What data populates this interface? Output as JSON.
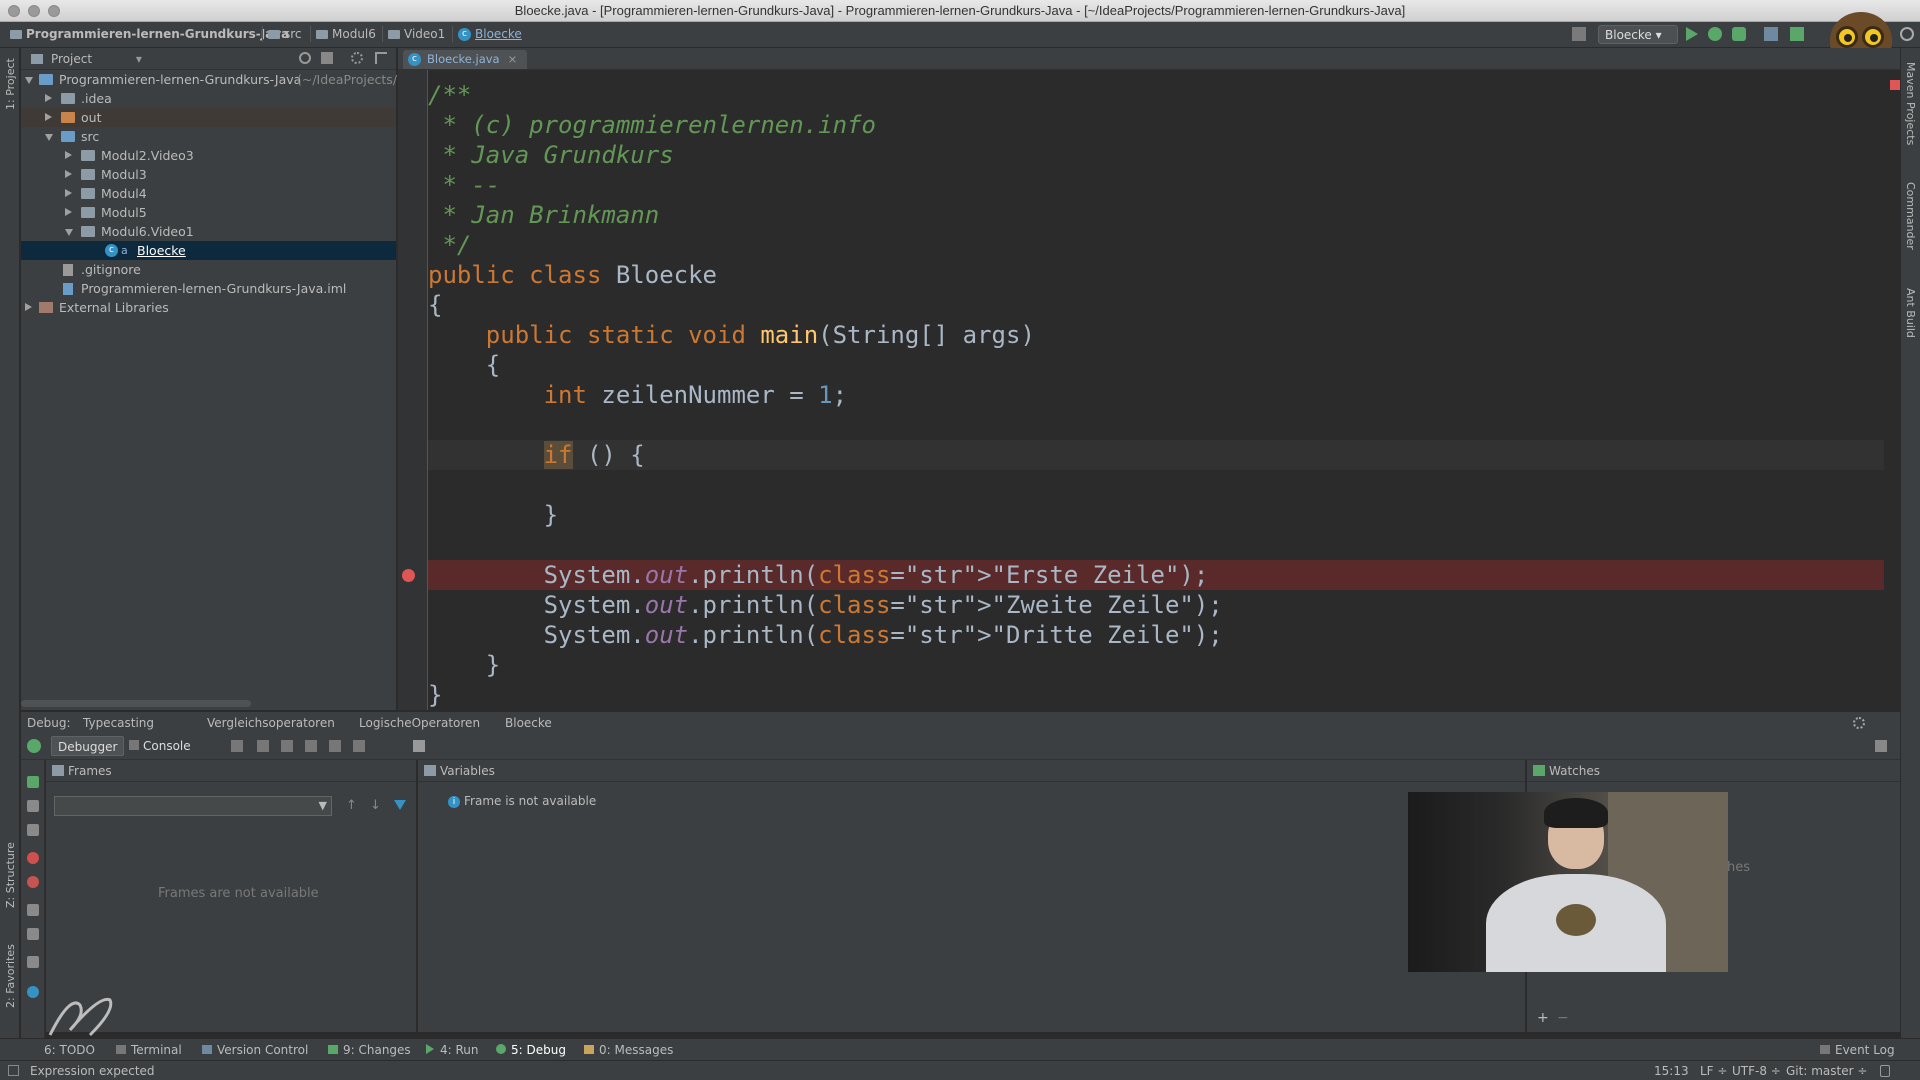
{
  "window": {
    "title": "Bloecke.java - [Programmieren-lernen-Grundkurs-Java] - Programmieren-lernen-Grundkurs-Java - [~/IdeaProjects/Programmieren-lernen-Grundkurs-Java]"
  },
  "navbar": {
    "breadcrumbs": [
      "Programmieren-lernen-Grundkurs-Java",
      "src",
      "Modul6",
      "Video1",
      "Bloecke"
    ],
    "run_config": "Bloecke"
  },
  "left_stripe": {
    "project": "1: Project",
    "structure": "Z: Structure",
    "favorites": "2: Favorites"
  },
  "right_stripe": {
    "maven": "Maven Projects",
    "commander": "Commander",
    "ant": "Ant Build"
  },
  "project_panel": {
    "header": "Project",
    "tree": [
      {
        "label": "Programmieren-lernen-Grundkurs-Java",
        "suffix": "(~/IdeaProjects/P",
        "depth": 0,
        "expanded": true,
        "icon": "module-folder-icon"
      },
      {
        "label": ".idea",
        "depth": 1,
        "expanded": false,
        "icon": "folder-icon"
      },
      {
        "label": "out",
        "depth": 1,
        "expanded": false,
        "icon": "excluded-folder-icon"
      },
      {
        "label": "src",
        "depth": 1,
        "expanded": true,
        "icon": "source-folder-icon"
      },
      {
        "label": "Modul2.Video3",
        "depth": 2,
        "expanded": false,
        "icon": "package-icon"
      },
      {
        "label": "Modul3",
        "depth": 2,
        "expanded": false,
        "icon": "package-icon"
      },
      {
        "label": "Modul4",
        "depth": 2,
        "expanded": false,
        "icon": "package-icon"
      },
      {
        "label": "Modul5",
        "depth": 2,
        "expanded": false,
        "icon": "package-icon"
      },
      {
        "label": "Modul6.Video1",
        "depth": 2,
        "expanded": true,
        "icon": "package-icon"
      },
      {
        "label": "Bloecke",
        "depth": 3,
        "selected": true,
        "icon": "java-class-icon"
      },
      {
        "label": ".gitignore",
        "depth": 1,
        "icon": "file-icon"
      },
      {
        "label": "Programmieren-lernen-Grundkurs-Java.iml",
        "depth": 1,
        "icon": "iml-file-icon"
      },
      {
        "label": "External Libraries",
        "depth": 0,
        "expanded": false,
        "icon": "library-icon"
      }
    ]
  },
  "editor": {
    "tab_label": "Bloecke.java",
    "lines": [
      "/**",
      " * (c) programmierenlernen.info",
      " * Java Grundkurs",
      " * --",
      " * Jan Brinkmann",
      " */",
      "public class Bloecke",
      "{",
      "    public static void main(String[] args)",
      "    {",
      "        int zeilenNummer = 1;",
      "",
      "        if () {",
      "",
      "        }",
      "",
      "        System.out.println(\"Erste Zeile\");",
      "        System.out.println(\"Zweite Zeile\");",
      "        System.out.println(\"Dritte Zeile\");",
      "    }",
      "}"
    ],
    "breakpoint_line": 17,
    "current_line": 13
  },
  "debug": {
    "label": "Debug:",
    "sessions": [
      "Typecasting",
      "Vergleichsoperatoren",
      "LogischeOperatoren",
      "Bloecke"
    ],
    "tabs": [
      "Debugger",
      "Console"
    ],
    "frames_title": "Frames",
    "frames_empty": "Frames are not available",
    "variables_title": "Variables",
    "variables_msg": "Frame is not available",
    "watches_title": "Watches",
    "watches_partial": "hes"
  },
  "bottom_tabs": {
    "todo": "6: TODO",
    "terminal": "Terminal",
    "vcs": "Version Control",
    "changes": "9: Changes",
    "run": "4: Run",
    "debug": "5: Debug",
    "messages": "0: Messages",
    "event_log": "Event Log"
  },
  "status": {
    "message": "Expression expected",
    "position": "15:13",
    "line_sep": "LF",
    "encoding": "UTF-8",
    "git": "Git: master"
  },
  "colors": {
    "editor_bg": "#2b2b2b",
    "keyword": "#cc7832",
    "string": "#6a8759",
    "number": "#6897bb",
    "comment": "#629755",
    "breakpoint": "#e05555"
  }
}
